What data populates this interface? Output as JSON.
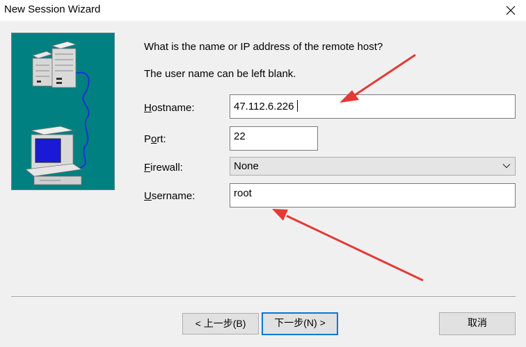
{
  "window": {
    "title": "New Session Wizard"
  },
  "prompt": {
    "line1": "What is the name or IP address of the remote host?",
    "line2": "The user name can be left blank."
  },
  "fields": {
    "hostname": {
      "label_accel": "H",
      "label_rest": "ostname:",
      "value": "47.112.6.226"
    },
    "port": {
      "label_pre": "P",
      "label_accel": "o",
      "label_rest": "rt:",
      "value": "22"
    },
    "firewall": {
      "label_accel": "F",
      "label_rest": "irewall:",
      "value": "None"
    },
    "username": {
      "label_accel": "U",
      "label_rest": "sername:",
      "value": "root"
    }
  },
  "buttons": {
    "back": "< 上一步(B)",
    "next": "下一步(N) >",
    "cancel": "取消"
  },
  "colors": {
    "accent": "#0078d7",
    "annotation_arrow": "#e53935",
    "illustration_bg": "#008080"
  }
}
